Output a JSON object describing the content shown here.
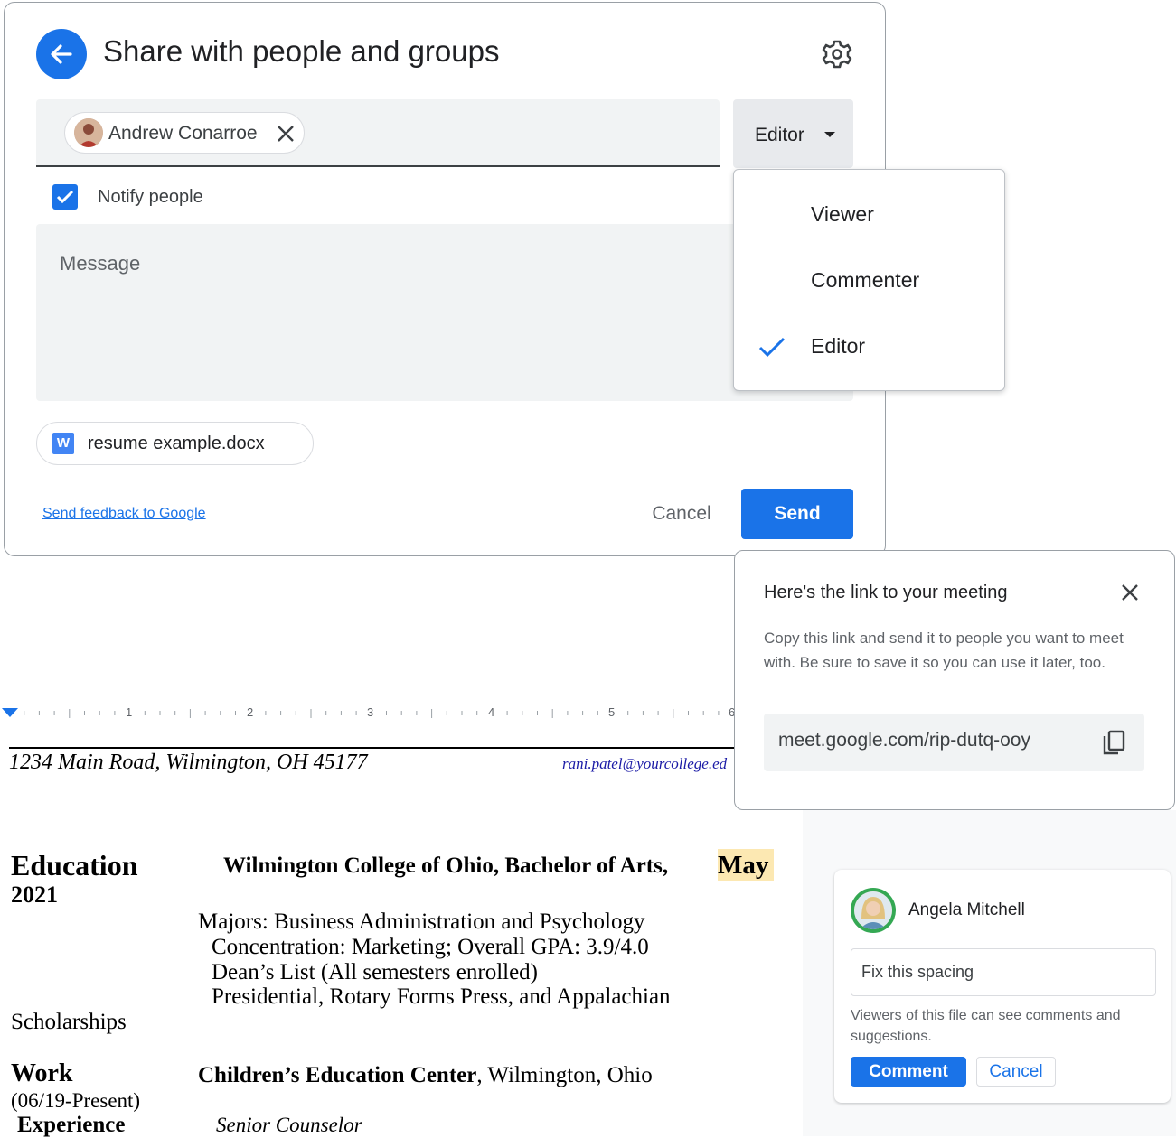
{
  "share_dialog": {
    "title": "Share with people and groups",
    "recipient_chip": "Andrew Conarroe",
    "role_selected": "Editor",
    "notify_label": "Notify people",
    "notify_checked": true,
    "message_placeholder": "Message",
    "attachment": "resume example.docx",
    "attachment_icon_letter": "W",
    "feedback_link": "Send feedback to Google",
    "cancel_label": "Cancel",
    "send_label": "Send",
    "accent_color": "#1a73e8"
  },
  "role_menu": {
    "options": [
      "Viewer",
      "Commenter",
      "Editor"
    ],
    "checked": "Editor"
  },
  "meet_popup": {
    "title": "Here's the link to your meeting",
    "body": "Copy this link and send it to people you want to meet with. Be sure to save it so you can use it later, too.",
    "link": "meet.google.com/rip-dutq-ooy"
  },
  "ruler": {
    "numbers": [
      "1",
      "2",
      "3",
      "4",
      "5",
      "6"
    ]
  },
  "document": {
    "address": "1234 Main Road, Wilmington, OH 45177",
    "email": "rani.patel@yourcollege.ed",
    "education_heading": "Education",
    "education_year": "2021",
    "education_school": "Wilmington College of Ohio, Bachelor of Arts,",
    "education_highlight": "May",
    "education_lines": [
      "Majors: Business Administration and Psychology",
      "Concentration:  Marketing; Overall GPA: 3.9/4.0",
      "Dean’s List (All semesters enrolled)",
      "Presidential, Rotary Forms Press, and Appalachian",
      "Scholarships"
    ],
    "work_heading": "Work",
    "work_dates": "(06/19-Present)",
    "experience_heading": "Experience",
    "work_org_bold": "Children’s Education Center",
    "work_org_rest": ", Wilmington, Ohio",
    "work_role": "Senior Counselor"
  },
  "comment": {
    "author": "Angela Mitchell",
    "input_value": "Fix this spacing",
    "note": "Viewers of this file can see comments and suggestions.",
    "comment_label": "Comment",
    "cancel_label": "Cancel"
  }
}
